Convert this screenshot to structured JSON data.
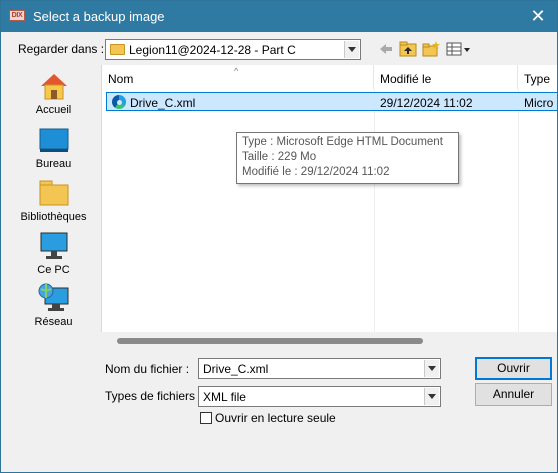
{
  "window": {
    "title": "Select a backup image",
    "app_icon_text": "DIX",
    "close_glyph": "✕"
  },
  "lookin": {
    "label": "Regarder dans :",
    "value": "Legion11@2024-12-28 - Part C"
  },
  "toolbar_icons": [
    "back-arrow-icon",
    "up-folder-icon",
    "new-folder-icon",
    "view-menu-icon"
  ],
  "places": [
    {
      "label": "Accueil",
      "icon": "home-icon"
    },
    {
      "label": "Bureau",
      "icon": "desktop-icon"
    },
    {
      "label": "Bibliothèques",
      "icon": "libraries-icon"
    },
    {
      "label": "Ce PC",
      "icon": "computer-icon"
    },
    {
      "label": "Réseau",
      "icon": "network-icon"
    }
  ],
  "filelist": {
    "columns": [
      "Nom",
      "Modifié le",
      "Type"
    ],
    "rows": [
      {
        "name": "Drive_C.xml",
        "modified": "29/12/2024 11:02",
        "type": "Micro",
        "icon": "edge-document-icon"
      }
    ]
  },
  "tooltip": {
    "line1": "Type : Microsoft Edge HTML Document",
    "line2": "Taille : 229 Mo",
    "line3": "Modifié le : 29/12/2024 11:02"
  },
  "form": {
    "filename_label": "Nom du fichier :",
    "filename_value": "Drive_C.xml",
    "filetype_label": "Types de fichiers :",
    "filetype_value": "XML file",
    "readonly_label": "Ouvrir en lecture seule",
    "readonly_checked": false
  },
  "buttons": {
    "open": "Ouvrir",
    "cancel": "Annuler"
  },
  "colors": {
    "titlebar": "#2f7aa3",
    "selection": "#cce8ff",
    "selection_border": "#0078d7"
  }
}
